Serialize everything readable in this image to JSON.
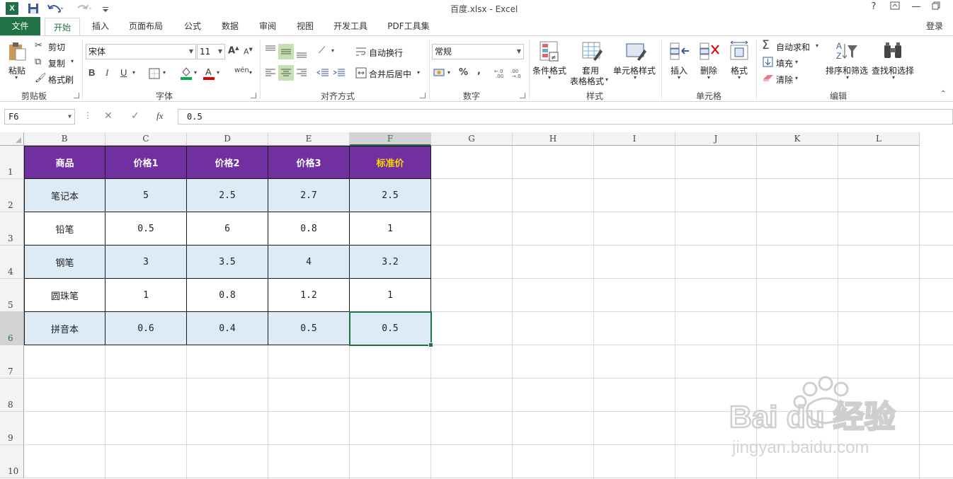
{
  "titlebar": {
    "title": "百度.xlsx - Excel",
    "help": "?",
    "restore": "🗗"
  },
  "tabs": {
    "file": "文件",
    "items": [
      "开始",
      "插入",
      "页面布局",
      "公式",
      "数据",
      "审阅",
      "视图",
      "开发工具",
      "PDF工具集"
    ],
    "login": "登录"
  },
  "ribbon": {
    "clipboard": {
      "label": "剪贴板",
      "paste": "粘贴",
      "cut": "剪切",
      "copy": "复制",
      "format_painter": "格式刷"
    },
    "font": {
      "label": "字体",
      "font_name": "宋体",
      "font_size": "11",
      "bold": "B",
      "italic": "I",
      "underline": "U",
      "phonetic": "wén"
    },
    "alignment": {
      "label": "对齐方式",
      "wrap": "自动换行",
      "merge": "合并后居中"
    },
    "number": {
      "label": "数字",
      "format": "常规",
      "percent": "%",
      "comma": ","
    },
    "styles": {
      "label": "样式",
      "conditional": "条件格式",
      "table_fmt_1": "套用",
      "table_fmt_2": "表格格式",
      "cell_styles": "单元格样式"
    },
    "cells": {
      "label": "单元格",
      "insert": "插入",
      "delete": "删除",
      "format": "格式"
    },
    "editing": {
      "label": "编辑",
      "autosum": "自动求和",
      "fill": "填充",
      "clear": "清除",
      "sort_filter": "排序和筛选",
      "find_select": "查找和选择"
    }
  },
  "formula_bar": {
    "name_box": "F6",
    "fx": "fx",
    "value": "0.5"
  },
  "grid": {
    "columns": [
      "B",
      "C",
      "D",
      "E",
      "F",
      "G",
      "H",
      "I",
      "J",
      "K",
      "L"
    ],
    "rows": [
      "1",
      "2",
      "3",
      "4",
      "5",
      "6",
      "7",
      "8",
      "9",
      "10"
    ],
    "selected_column": "F",
    "selected_row": "6",
    "table": {
      "header": [
        "商品",
        "价格1",
        "价格2",
        "价格3",
        "标准价"
      ],
      "body": [
        [
          "笔记本",
          "5",
          "2.5",
          "2.7",
          "2.5"
        ],
        [
          "铅笔",
          "0.5",
          "6",
          "0.8",
          "1"
        ],
        [
          "钢笔",
          "3",
          "3.5",
          "4",
          "3.2"
        ],
        [
          "圆珠笔",
          "1",
          "0.8",
          "1.2",
          "1"
        ],
        [
          "拼音本",
          "0.6",
          "0.4",
          "0.5",
          "0.5"
        ]
      ]
    }
  },
  "watermark": {
    "brand": "Bai du 经验",
    "url": "jingyan.baidu.com"
  },
  "colors": {
    "excel_green": "#217346",
    "header_purple": "#7030a0",
    "header_gold": "#ffd800",
    "band_blue": "#ddebf7"
  }
}
